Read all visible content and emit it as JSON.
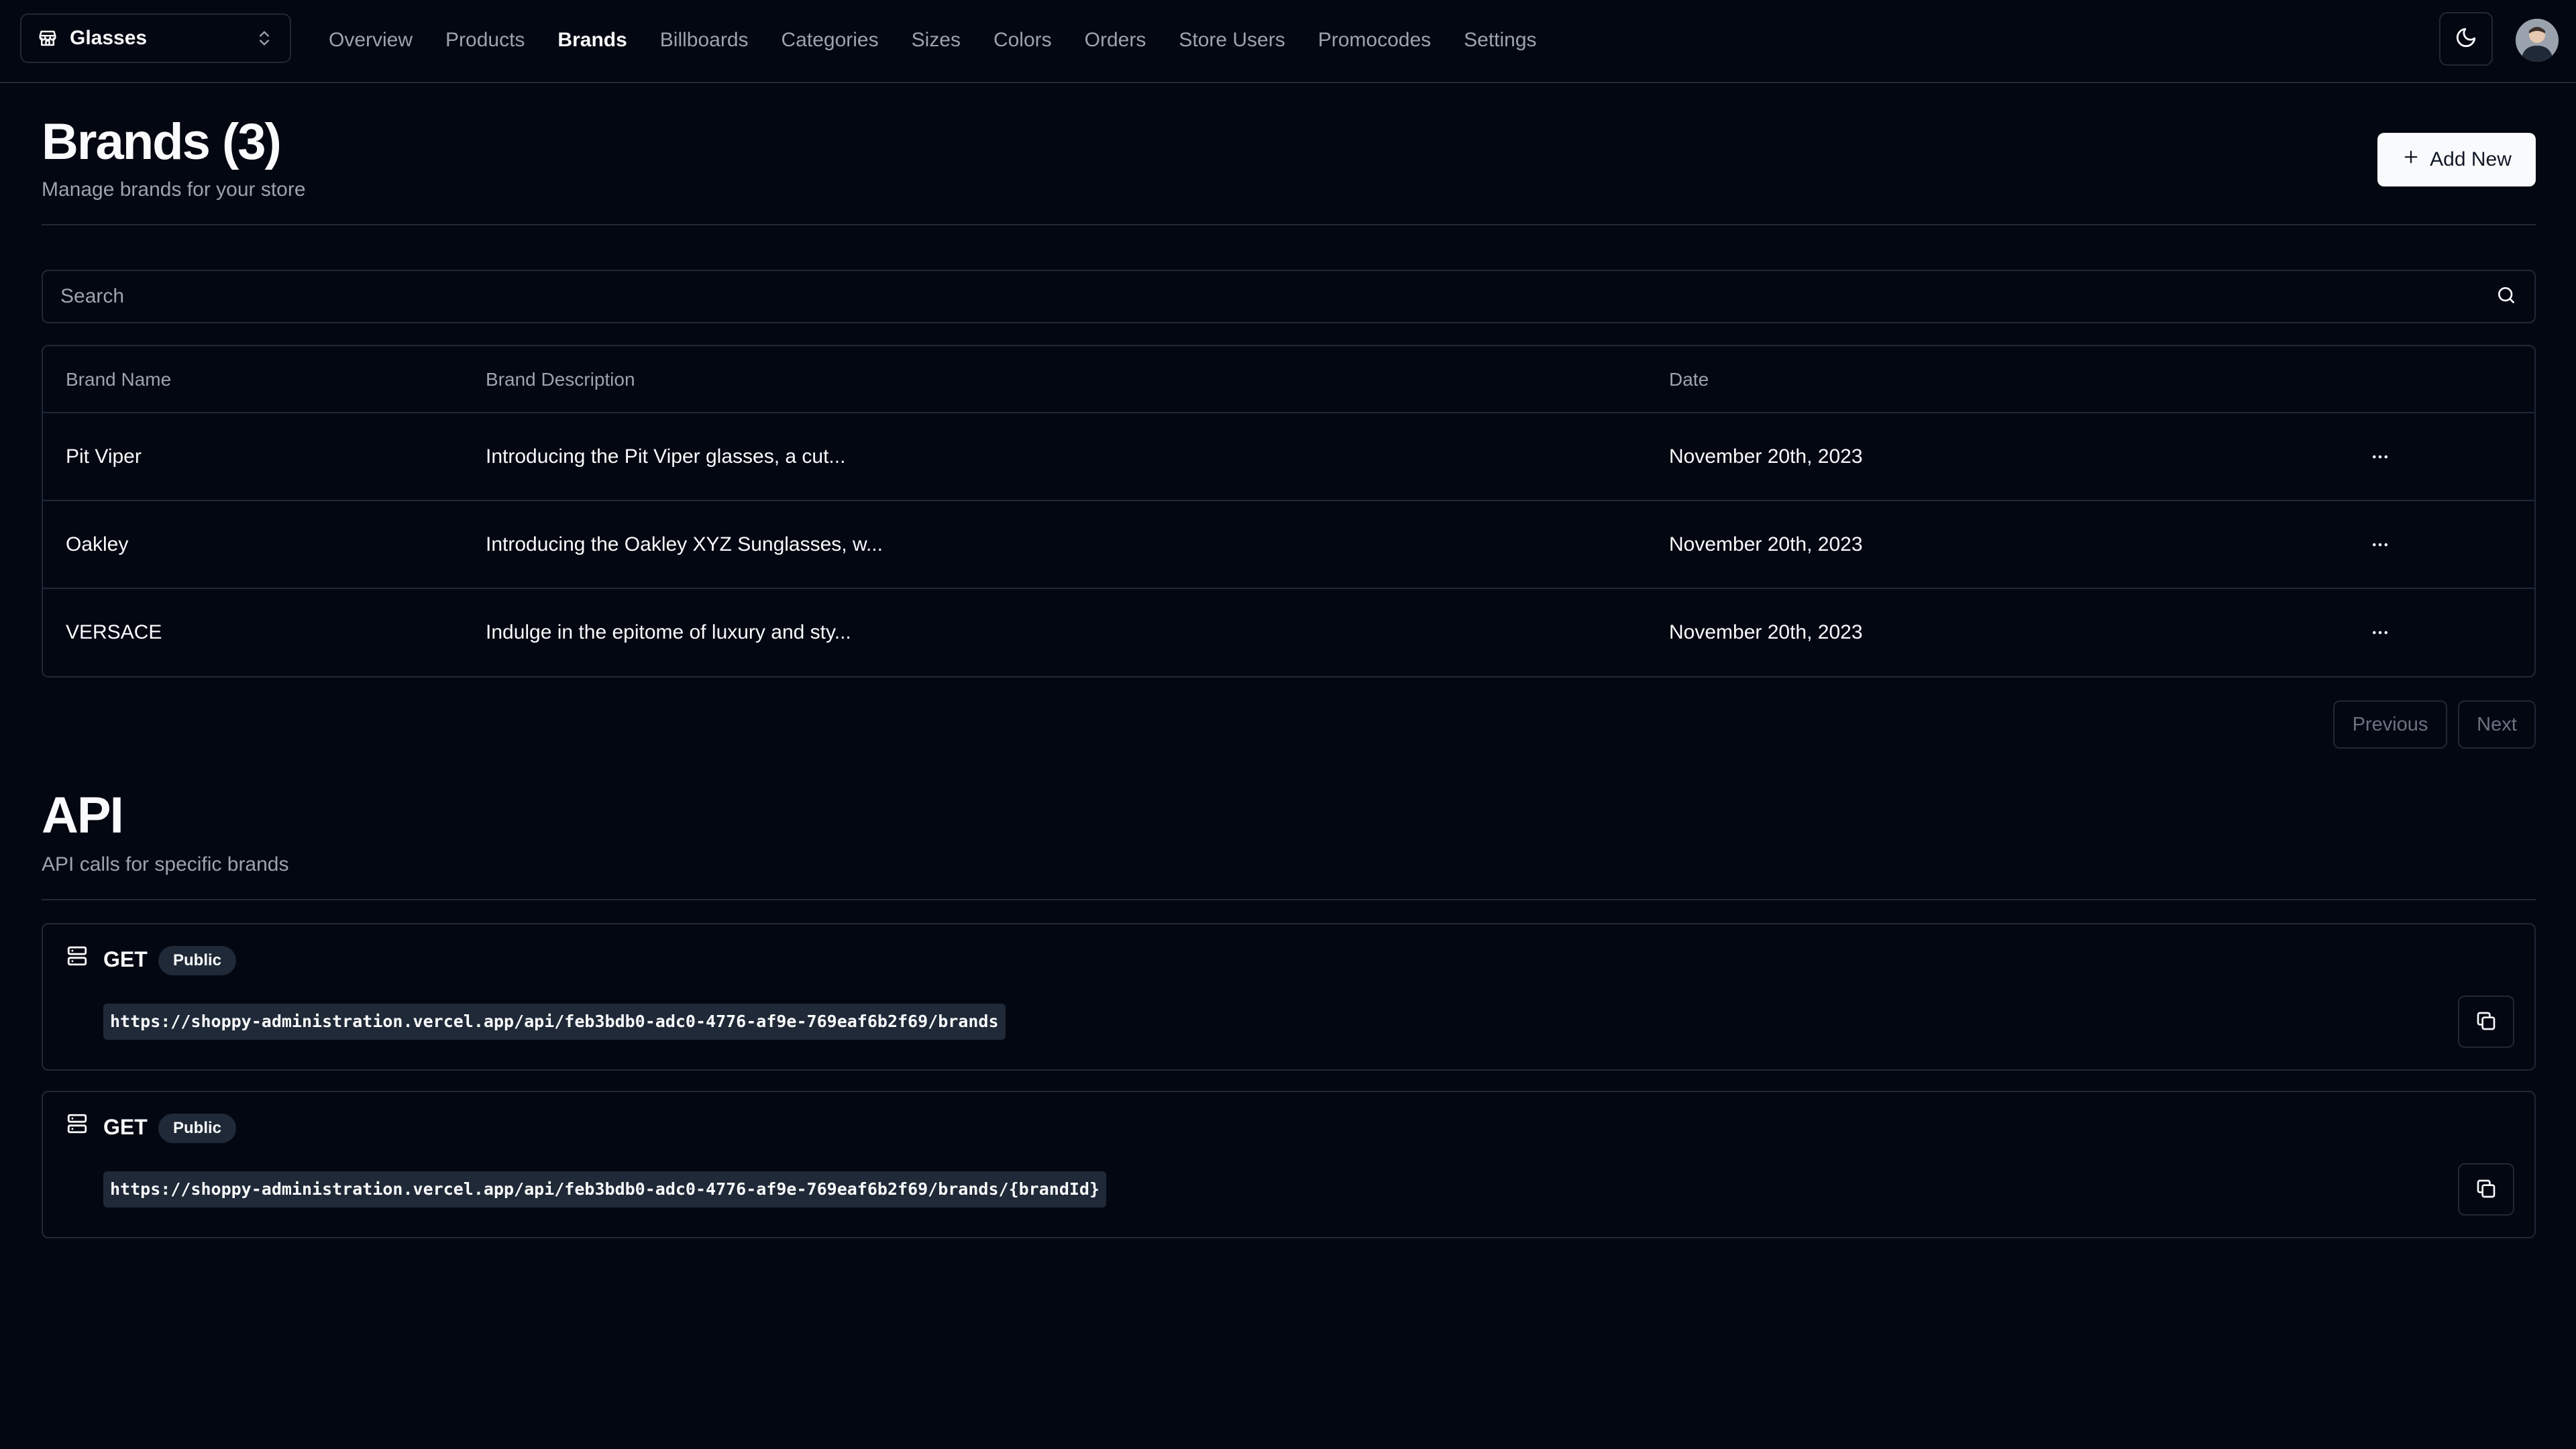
{
  "store_switcher": {
    "name": "Glasses"
  },
  "nav": {
    "items": [
      {
        "label": "Overview",
        "active": false
      },
      {
        "label": "Products",
        "active": false
      },
      {
        "label": "Brands",
        "active": true
      },
      {
        "label": "Billboards",
        "active": false
      },
      {
        "label": "Categories",
        "active": false
      },
      {
        "label": "Sizes",
        "active": false
      },
      {
        "label": "Colors",
        "active": false
      },
      {
        "label": "Orders",
        "active": false
      },
      {
        "label": "Store Users",
        "active": false
      },
      {
        "label": "Promocodes",
        "active": false
      },
      {
        "label": "Settings",
        "active": false
      }
    ]
  },
  "header": {
    "title": "Brands (3)",
    "subtitle": "Manage brands for your store",
    "add_label": "Add New"
  },
  "search": {
    "placeholder": "Search"
  },
  "table": {
    "columns": [
      "Brand Name",
      "Brand Description",
      "Date"
    ],
    "rows": [
      {
        "name": "Pit Viper",
        "description": "Introducing the Pit Viper glasses, a cut...",
        "date": "November 20th, 2023"
      },
      {
        "name": "Oakley",
        "description": "Introducing the Oakley XYZ Sunglasses, w...",
        "date": "November 20th, 2023"
      },
      {
        "name": "VERSACE",
        "description": "Indulge in the epitome of luxury and sty...",
        "date": "November 20th, 2023"
      }
    ]
  },
  "pagination": {
    "previous": "Previous",
    "next": "Next"
  },
  "api": {
    "title": "API",
    "subtitle": "API calls for specific brands",
    "endpoints": [
      {
        "method": "GET",
        "access": "Public",
        "url": "https://shoppy-administration.vercel.app/api/feb3bdb0-adc0-4776-af9e-769eaf6b2f69/brands"
      },
      {
        "method": "GET",
        "access": "Public",
        "url": "https://shoppy-administration.vercel.app/api/feb3bdb0-adc0-4776-af9e-769eaf6b2f69/brands/{brandId}"
      }
    ]
  },
  "colors": {
    "background": "#030712",
    "border": "#1f2937",
    "text": "#f9fafb",
    "muted": "#9ca3af",
    "badge": "#1f2937"
  },
  "icons": {
    "store": "store-icon",
    "switcher": "chevrons-up-down-icon",
    "theme": "moon-icon",
    "add": "plus-icon",
    "search": "search-icon",
    "row_menu": "more-horizontal-icon",
    "endpoint": "server-icon",
    "copy": "copy-icon"
  }
}
